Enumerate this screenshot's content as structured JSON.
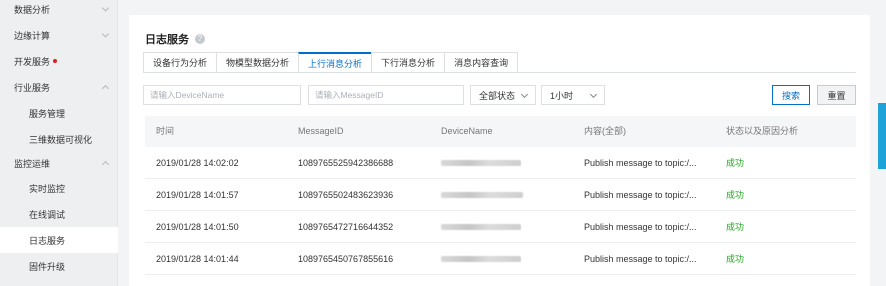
{
  "sidebar": {
    "items": [
      {
        "label": "数据分析",
        "type": "top",
        "chevron": "down"
      },
      {
        "label": "边缘计算",
        "type": "top",
        "chevron": "down"
      },
      {
        "label": "开发服务",
        "type": "top",
        "dot": true
      },
      {
        "label": "行业服务",
        "type": "top",
        "chevron": "up"
      },
      {
        "label": "服务管理",
        "type": "sub"
      },
      {
        "label": "三维数据可视化",
        "type": "sub"
      },
      {
        "label": "监控运维",
        "type": "top",
        "chevron": "up"
      },
      {
        "label": "实时监控",
        "type": "sub"
      },
      {
        "label": "在线调试",
        "type": "sub"
      },
      {
        "label": "日志服务",
        "type": "sub",
        "active": true
      },
      {
        "label": "固件升级",
        "type": "sub"
      }
    ]
  },
  "page": {
    "title": "日志服务",
    "help_icon": "?"
  },
  "tabs": [
    "设备行为分析",
    "物模型数据分析",
    "上行消息分析",
    "下行消息分析",
    "消息内容查询"
  ],
  "active_tab": 2,
  "filters": {
    "device_placeholder": "请输入DeviceName",
    "message_placeholder": "请输入MessageID",
    "status_value": "全部状态",
    "time_value": "1小时",
    "search_label": "搜索",
    "reset_label": "重置"
  },
  "table": {
    "columns": [
      "时间",
      "MessageID",
      "DeviceName",
      "内容(全部)",
      "状态以及原因分析"
    ],
    "rows": [
      {
        "time": "2019/01/28 14:02:02",
        "message_id": "1089765525942386688",
        "device": "",
        "content": "Publish message to topic:/...",
        "status": "成功"
      },
      {
        "time": "2019/01/28 14:01:57",
        "message_id": "1089765502483623936",
        "device": "",
        "content": "Publish message to topic:/...",
        "status": "成功"
      },
      {
        "time": "2019/01/28 14:01:50",
        "message_id": "1089765472716644352",
        "device": "",
        "content": "Publish message to topic:/...",
        "status": "成功"
      },
      {
        "time": "2019/01/28 14:01:44",
        "message_id": "1089765450767855616",
        "device": "",
        "content": "Publish message to topic:/...",
        "status": "成功"
      }
    ]
  },
  "colors": {
    "accent": "#0070cc",
    "success": "#22a91c",
    "alert_dot": "#e02020"
  }
}
